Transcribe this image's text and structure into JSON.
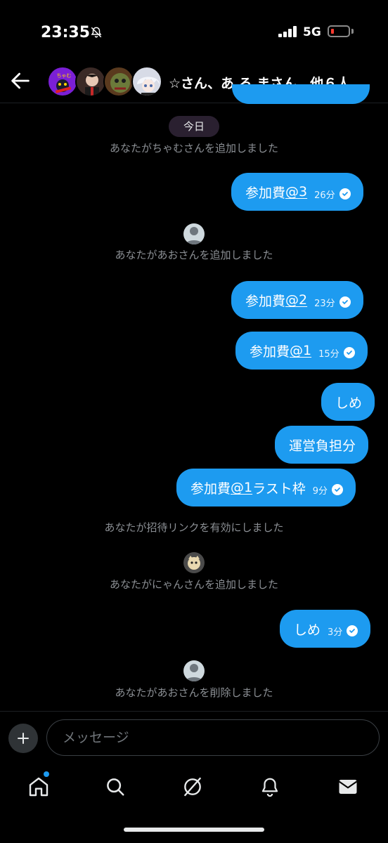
{
  "status_bar": {
    "time": "23:35",
    "network": "5G"
  },
  "header": {
    "title": "☆さん、あ ろ まさん、他６人"
  },
  "chat": {
    "date_pill": "今日",
    "system_messages": [
      "あなたがちゃむさんを追加しました",
      "あなたがあおさんを追加しました",
      "あなたが招待リンクを有効にしました",
      "あなたがにゃんさんを追加しました",
      "あなたがあおさんを削除しました"
    ],
    "messages": [
      {
        "prefix": "参加費",
        "link": "@3",
        "suffix": "",
        "time": "26分"
      },
      {
        "prefix": "参加費",
        "link": "@2",
        "suffix": "",
        "time": "23分"
      },
      {
        "prefix": "参加費",
        "link": "@1",
        "suffix": "",
        "time": "15分"
      },
      {
        "prefix": "しめ",
        "link": "",
        "suffix": "",
        "time": ""
      },
      {
        "prefix": "運営負担分",
        "link": "",
        "suffix": "",
        "time": ""
      },
      {
        "prefix": "参加費",
        "link": "@1",
        "suffix": "ラスト枠",
        "time": "9分"
      },
      {
        "prefix": "しめ",
        "link": "",
        "suffix": "",
        "time": "3分"
      }
    ]
  },
  "composer": {
    "placeholder": "メッセージ"
  },
  "tab_bar": {
    "items": [
      "home-icon",
      "search-icon",
      "grok-icon",
      "notifications-icon",
      "messages-icon"
    ]
  },
  "colors": {
    "accent": "#1d9bf0",
    "background": "#000000",
    "system_text": "#8b8f94"
  }
}
